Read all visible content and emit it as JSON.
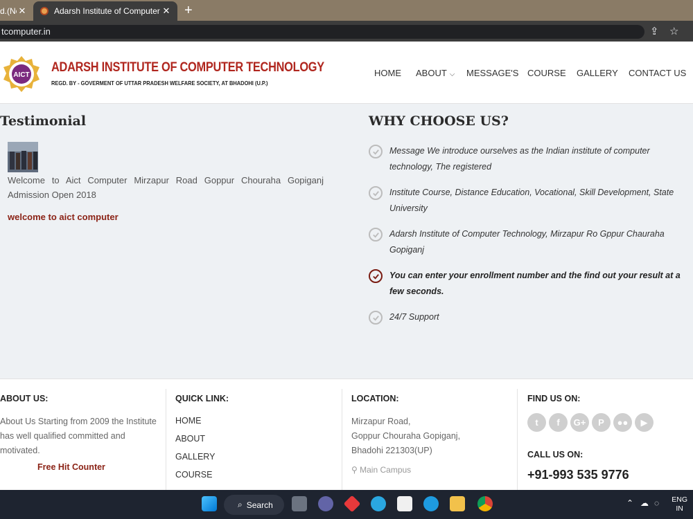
{
  "browser": {
    "tabs": [
      {
        "title": "d.(Ne"
      },
      {
        "title": "Adarsh Institute of Computer Tec"
      }
    ],
    "url": "tcomputer.in"
  },
  "header": {
    "logo_text": "AICT",
    "brand_name": "ADARSH INSTITUTE OF COMPUTER TECHNOLOGY",
    "brand_sub": "REGD. BY - GOVERMENT OF UTTAR PRADESH WELFARE SOCIETY, AT BHADOHI (U.P.)",
    "nav": [
      {
        "label": "HOME"
      },
      {
        "label": "ABOUT"
      },
      {
        "label": "MESSAGE'S"
      },
      {
        "label": "COURSE"
      },
      {
        "label": "GALLERY"
      },
      {
        "label": "CONTACT US"
      }
    ]
  },
  "testimonial": {
    "title": "Testimonial",
    "text": "Welcome to Aict Computer Mirzapur Road Goppur Chouraha Gopiganj Admission Open 2018",
    "link": "welcome to aict computer"
  },
  "why_choose": {
    "title": "WHY CHOOSE US?",
    "items": [
      {
        "text": "Message We introduce ourselves as the Indian institute of computer technology, The registered"
      },
      {
        "text": "Institute Course, Distance Education, Vocational, Skill Development, State University"
      },
      {
        "text": "Adarsh Institute of Computer Technology, Mirzapur Ro Gppur Chauraha Gopiganj"
      },
      {
        "text": "You can enter your enrollment number and the find out your result at a few seconds."
      },
      {
        "text": "24/7 Support"
      }
    ]
  },
  "footer": {
    "about": {
      "heading": "ABOUT US:",
      "text": "About Us Starting from 2009 the Institute has well qualified committed and motivated.",
      "counter": "Free Hit Counter"
    },
    "quick_links": {
      "heading": "QUICK LINK:",
      "items": [
        {
          "label": "HOME"
        },
        {
          "label": "ABOUT"
        },
        {
          "label": "GALLERY"
        },
        {
          "label": "COURSE"
        }
      ]
    },
    "location": {
      "heading": "LOCATION:",
      "lines": [
        "Mirzapur Road,",
        "Goppur Chouraha Gopiganj,",
        "Bhadohi 221303(UP)"
      ],
      "campus": "Main Campus"
    },
    "find_us": {
      "heading": "FIND US ON:",
      "call_heading": "CALL US ON:",
      "phone": "+91-993 535 9776"
    }
  },
  "taskbar": {
    "search": "Search",
    "lang": "ENG",
    "region": "IN"
  }
}
